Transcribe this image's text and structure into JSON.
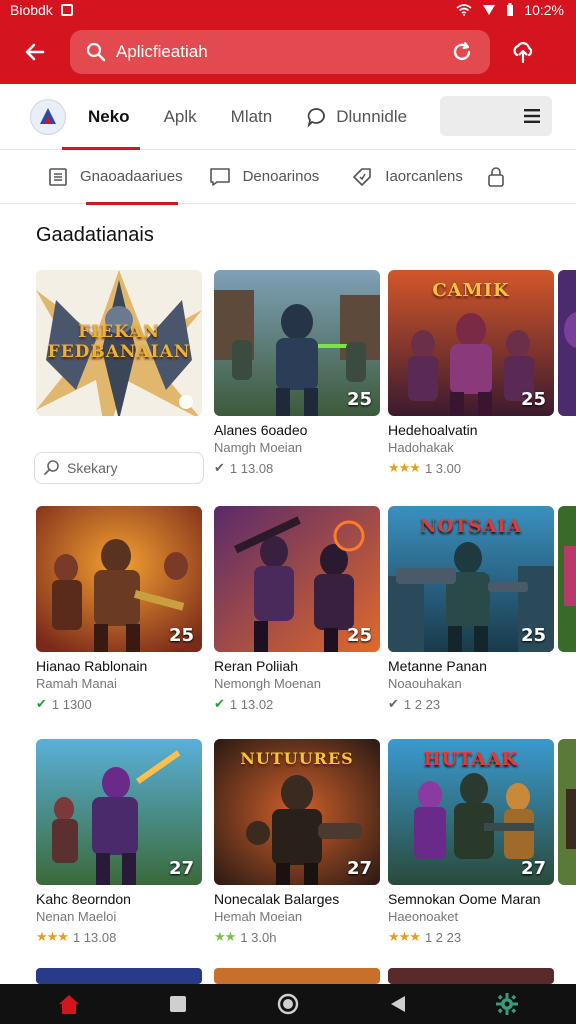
{
  "status_bar": {
    "app_label": "Biobdk",
    "time": "10:2%"
  },
  "search": {
    "text": "Aplicfieatiah"
  },
  "top_tabs": [
    {
      "label": "Neko"
    },
    {
      "label": "Aplk"
    },
    {
      "label": "Mlatn"
    },
    {
      "label": "Dlunnidle"
    }
  ],
  "sub_tabs": [
    {
      "label": "Gnaoadaariues"
    },
    {
      "label": "Denoarinos"
    },
    {
      "label": "Iaorcanlens"
    }
  ],
  "section_title": "Gaadatianais",
  "search_chip": "Skekary",
  "cards": [
    {
      "title": "",
      "sub": "",
      "meta": "",
      "num": "",
      "art_title": "FIEKAN FEDBANAIAN"
    },
    {
      "title": "Alanes 6oadeo",
      "sub": "Namgh Moeian",
      "meta": "1 13.08",
      "num": "25",
      "art_title": ""
    },
    {
      "title": "Hedehoalvatin",
      "sub": "Hadohakak",
      "meta": "1 3.00",
      "num": "25",
      "art_title": "CAMIK"
    },
    {
      "title": "Hianao Rablonain",
      "sub": "Ramah Manai",
      "meta": "1 1300",
      "num": "25",
      "art_title": ""
    },
    {
      "title": "Reran Poliiah",
      "sub": "Nemongh Moenan",
      "meta": "1 13.02",
      "num": "25",
      "art_title": ""
    },
    {
      "title": "Metanne Panan",
      "sub": "Noaouhakan",
      "meta": "1 2 23",
      "num": "25",
      "art_title": "NOTSAIA"
    },
    {
      "title": "Kahc 8eorndon",
      "sub": "Nenan Maeloi",
      "meta": "1 13.08",
      "num": "27",
      "art_title": ""
    },
    {
      "title": "Nonecalak Balarges",
      "sub": "Hemah Moeian",
      "meta": "1 3.0h",
      "num": "27",
      "art_title": "NUTUURES"
    },
    {
      "title": "Semnokan Oome Maran",
      "sub": "Haeonoaket",
      "meta": "1 2 23",
      "num": "27",
      "art_title": "HUTAAK"
    }
  ],
  "colors": {
    "brand_red": "#d4141f",
    "star": "#e7a01a",
    "check_green": "#2a9b33"
  }
}
